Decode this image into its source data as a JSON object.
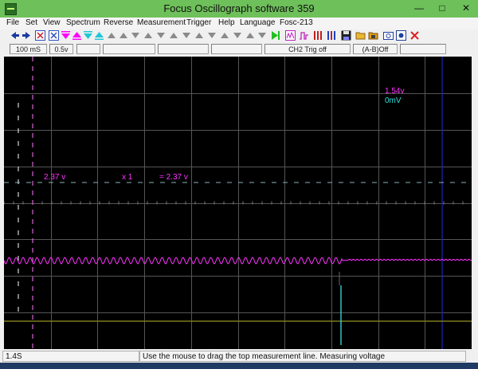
{
  "window": {
    "title": "Focus Oscillograph software 359"
  },
  "menu": [
    "File",
    "Set",
    "View",
    "Spectrum",
    "Reverse",
    "Measurement",
    "Trigger",
    "Help",
    "Language",
    "Fosc-213"
  ],
  "controls": {
    "timebase": "100 mS",
    "volts_div": "0.5v",
    "trigger": "CH2 Trig off",
    "math": "(A-B)Off"
  },
  "measure": {
    "voltage": "2.37 v",
    "multiplier": "x 1",
    "result": "= 2.37 v"
  },
  "channels": {
    "ch1_offset": "1.54v",
    "ch2_offset": "0mV"
  },
  "status": {
    "time": "1.4S",
    "message": "Use the mouse to drag the top measurement line. Measuring voltage"
  },
  "colors": {
    "ch1": "#ff33ff",
    "ch2": "#33e0e0",
    "grid": "#555555",
    "title_bg": "#6ec05a",
    "cursor_line": "#2020c0",
    "baseline": "#7a7a1e"
  },
  "icons": {
    "toolbar": [
      "arrow-left-icon",
      "arrow-right-icon",
      "x-box-icon",
      "x-box-icon",
      "triangle-down-icon",
      "triangle-up-icon",
      "triangle-down-icon",
      "triangle-up-icon",
      "run-icon",
      "fft-icon",
      "pulse-icon",
      "bars-icon",
      "bars-icon",
      "save-icon",
      "open-icon",
      "screenshot-icon",
      "record-icon",
      "settings-icon",
      "close-icon"
    ]
  }
}
